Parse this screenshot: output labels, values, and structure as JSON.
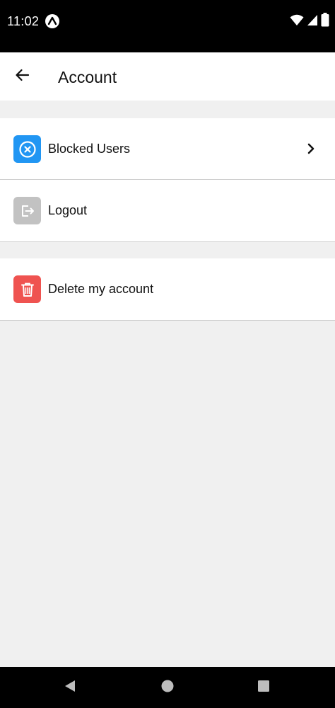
{
  "status_bar": {
    "time": "11:02",
    "app_icon": "expo-icon",
    "icons": [
      "wifi-icon",
      "cellular-signal-icon",
      "battery-icon"
    ]
  },
  "header": {
    "title": "Account",
    "back_icon": "arrow-left-icon"
  },
  "sections": [
    {
      "items": [
        {
          "label": "Blocked Users",
          "icon": "blocked-circle-x-icon",
          "icon_bg": "#2196f3",
          "has_chevron": true
        },
        {
          "label": "Logout",
          "icon": "logout-icon",
          "icon_bg": "#c2c2c2",
          "has_chevron": false
        }
      ]
    },
    {
      "items": [
        {
          "label": "Delete my account",
          "icon": "trash-icon",
          "icon_bg": "#ef5350",
          "has_chevron": false
        }
      ]
    }
  ],
  "nav_bar": {
    "buttons": [
      "back-triangle-icon",
      "home-circle-icon",
      "recents-square-icon"
    ]
  },
  "colors": {
    "background": "#f0f0f0",
    "surface": "#ffffff",
    "system_bars": "#000000",
    "blocked_icon_bg": "#2196f3",
    "logout_icon_bg": "#c2c2c2",
    "delete_icon_bg": "#ef5350"
  }
}
